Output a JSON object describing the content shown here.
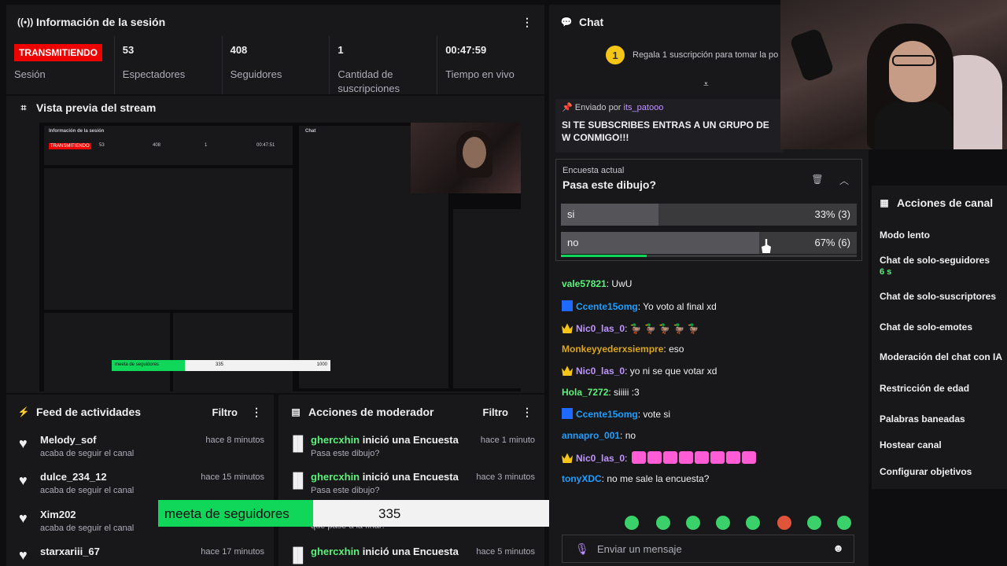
{
  "session": {
    "title": "Información de la sesión",
    "live_badge": "TRANSMITIENDO",
    "live_label": "Sesión",
    "stats": [
      {
        "value": "53",
        "label": "Espectadores"
      },
      {
        "value": "408",
        "label": "Seguidores"
      },
      {
        "value": "1",
        "label": "Cantidad de suscripciones"
      },
      {
        "value": "00:47:59",
        "label": "Tiempo en vivo"
      }
    ]
  },
  "preview": {
    "title": "Vista previa del stream",
    "mini_session_title": "Información de la sesión",
    "mini_live": "TRANSMITIENDO",
    "mini_stats": [
      "53",
      "408",
      "1",
      "00:47:51"
    ],
    "mini_chat_title": "Chat",
    "mini_goal": "meeta de seguidores",
    "mini_goal_current": "335",
    "mini_goal_max": "1000"
  },
  "feed": {
    "title": "Feed de actividades",
    "filter_label": "Filtro",
    "items": [
      {
        "user": "Melody_sof",
        "action": "acaba de seguir el canal",
        "time": "hace 8 minutos"
      },
      {
        "user": "dulce_234_12",
        "action": "acaba de seguir el canal",
        "time": "hace 15 minutos"
      },
      {
        "user": "Xim202",
        "action": "acaba de seguir el canal",
        "time": ""
      },
      {
        "user": "starxariii_67",
        "action": "",
        "time": "hace 17 minutos"
      }
    ]
  },
  "mod": {
    "title": "Acciones de moderador",
    "filter_label": "Filtro",
    "items": [
      {
        "user": "ghercxhin",
        "action": "inició una Encuesta",
        "detail": "Pasa este dibujo?",
        "time": "hace 1 minuto"
      },
      {
        "user": "ghercxhin",
        "action": "inició una Encuesta",
        "detail": "Pasa este dibujo?",
        "time": "hace 3 minutos"
      },
      {
        "user": "",
        "action": "",
        "detail": "que pase a la final?",
        "time": ""
      },
      {
        "user": "ghercxhin",
        "action": "inició una Encuesta",
        "detail": "",
        "time": "hace 5 minutos"
      }
    ]
  },
  "goal": {
    "label": "meeta de seguidores",
    "current": "335",
    "max": "1000",
    "progress": 0.335
  },
  "chat": {
    "title": "Chat",
    "gift_text": "Regala 1 suscripción para tomar la po",
    "gift_number": "1",
    "pinned_by_label": "Enviado por",
    "pinned_user": "its_patooo",
    "pinned_text": "SI TE SUBSCRIBES ENTRAS A UN GRUPO DE W CONMIGO!!!",
    "poll": {
      "label": "Encuesta actual",
      "question": "Pasa este dibujo?",
      "options": [
        {
          "name": "si",
          "result": "33% (3)",
          "fraction": 0.33
        },
        {
          "name": "no",
          "result": "67% (6)",
          "fraction": 0.67
        }
      ],
      "time_progress": 0.29
    },
    "messages": [
      {
        "user": "vale57821",
        "text": ": UwU",
        "color": "#5cf27a",
        "badge": ""
      },
      {
        "user": "Ccente15omg",
        "text": ": Yo voto al final xd",
        "color": "#1f9eff",
        "badge": "bolt"
      },
      {
        "user": "Nic0_las_0",
        "text": ": 🦆 🦆 🦆 🦆 🦆",
        "color": "#bf94ff",
        "badge": "crown"
      },
      {
        "user": "Monkeyyederxsiempre",
        "text": ": eso",
        "color": "#daa520",
        "badge": ""
      },
      {
        "user": "Nic0_las_0",
        "text": ": yo ni se que votar xd",
        "color": "#bf94ff",
        "badge": "crown"
      },
      {
        "user": "Hola_7272",
        "text": ": siiiii :3",
        "color": "#5cf27a",
        "badge": ""
      },
      {
        "user": "Ccente15omg",
        "text": ": vote si",
        "color": "#1f9eff",
        "badge": "bolt"
      },
      {
        "user": "annapro_001",
        "text": ": no",
        "color": "#1f9eff",
        "badge": ""
      },
      {
        "user": "Nic0_las_0",
        "text": ": ",
        "color": "#bf94ff",
        "badge": "crown"
      },
      {
        "user": "tonyXDC",
        "text": ": no me sale la encuesta?",
        "color": "#1f9eff",
        "badge": ""
      }
    ],
    "input_placeholder": "Enviar un mensaje"
  },
  "actions": {
    "title": "Acciones de canal",
    "items": [
      {
        "label": "Modo lento",
        "sub": ""
      },
      {
        "label": "Chat de solo-seguidores",
        "sub": "6 s"
      },
      {
        "label": "Chat de solo-suscriptores",
        "sub": ""
      },
      {
        "label": "Chat de solo-emotes",
        "sub": ""
      },
      {
        "label": "Moderación del chat con IA",
        "sub": ""
      },
      {
        "label": "Restricción de edad",
        "sub": ""
      },
      {
        "label": "Palabras baneadas",
        "sub": ""
      },
      {
        "label": "Hostear canal",
        "sub": ""
      },
      {
        "label": "Configurar objetivos",
        "sub": ""
      }
    ]
  }
}
